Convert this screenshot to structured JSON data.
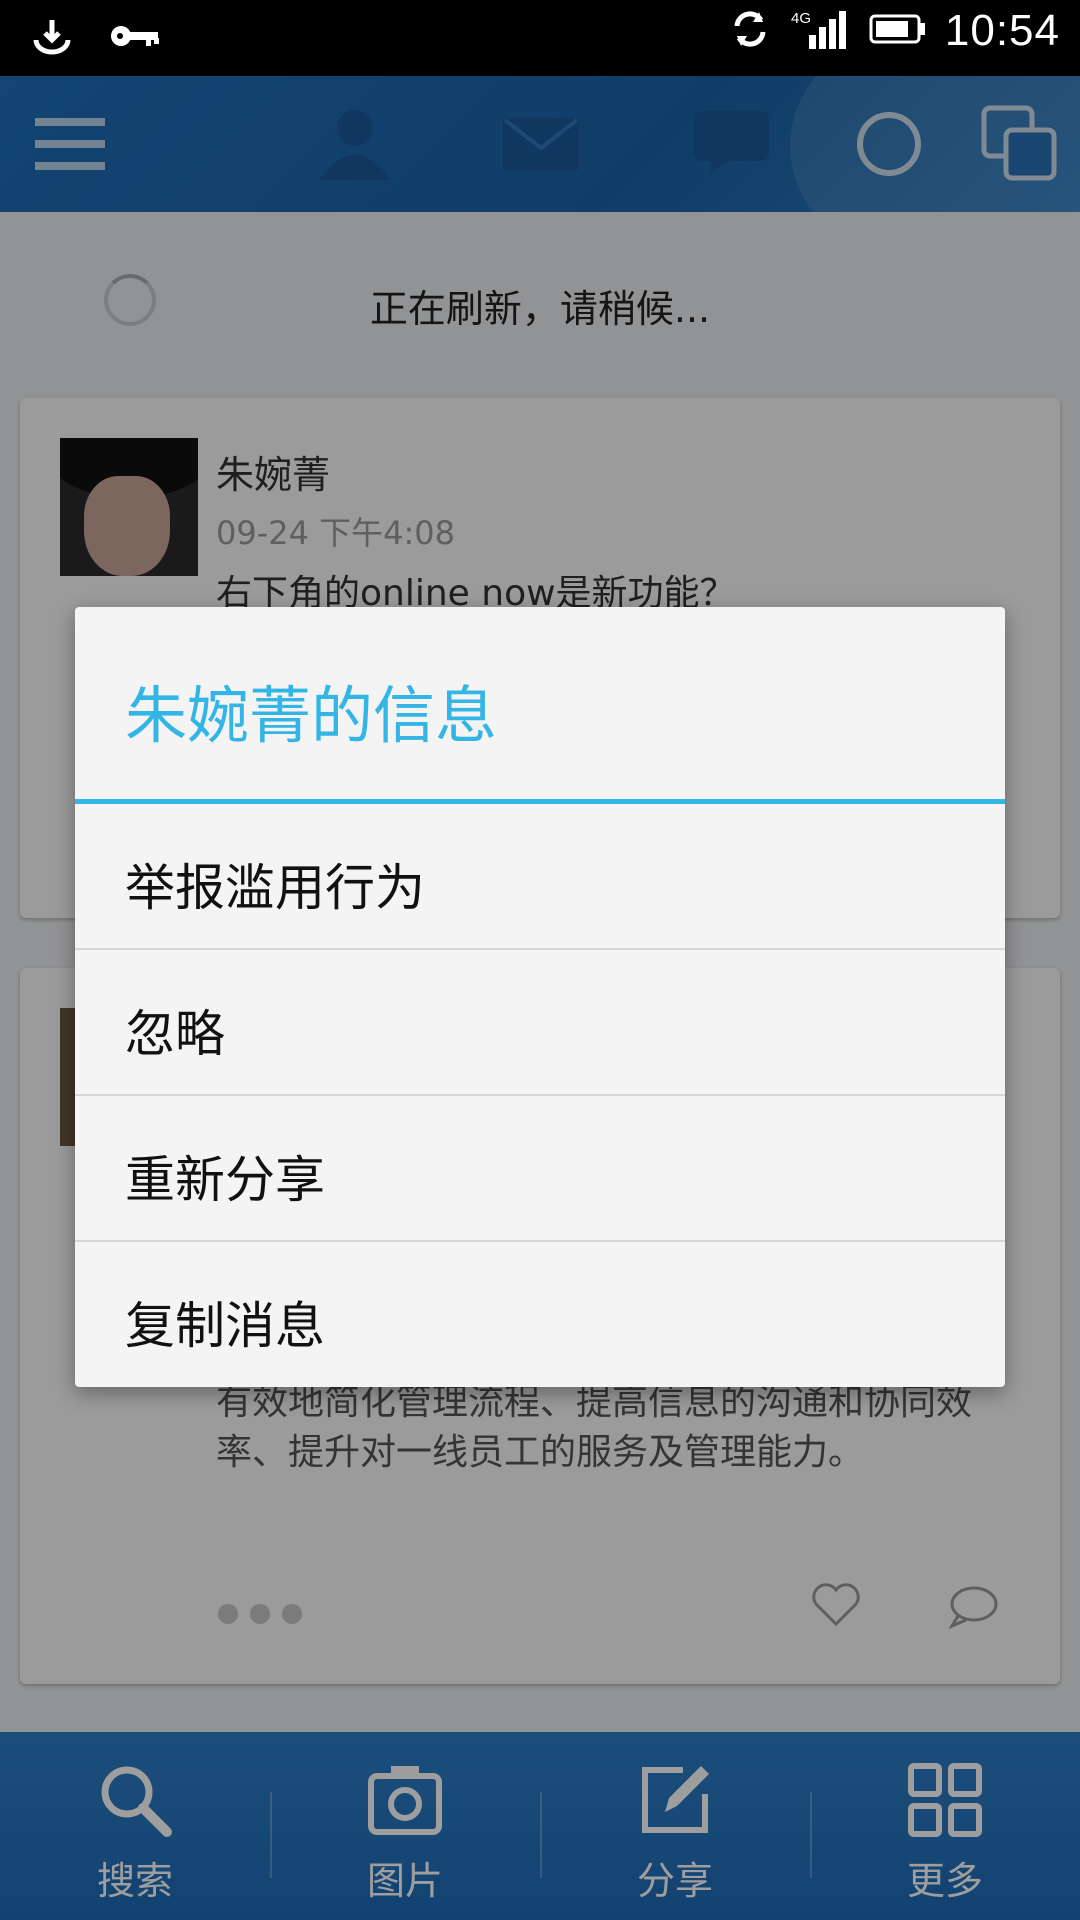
{
  "status_bar": {
    "time": "10:54",
    "network": "4G",
    "icons": [
      "download-icon",
      "key-icon",
      "sync-icon",
      "signal-icon",
      "battery-icon"
    ]
  },
  "top_bar": {
    "icons": [
      "menu-icon",
      "profile-icon",
      "mail-icon",
      "chat-icon",
      "circle-icon",
      "windows-icon"
    ]
  },
  "refresh": {
    "text": "正在刷新，请稍候..."
  },
  "posts": [
    {
      "author": "朱婉菁",
      "time": "09-24 下午4:08",
      "text": "右下角的online now是新功能？"
    },
    {
      "text": "有效地简化管理流程、提高信息的沟通和协同效率、提升对一线员工的服务及管理能力。"
    }
  ],
  "dialog": {
    "title": "朱婉菁的信息",
    "items": [
      "举报滥用行为",
      "忽略",
      "重新分享",
      "复制消息"
    ]
  },
  "bottom_bar": {
    "items": [
      {
        "label": "搜索",
        "icon": "search-icon"
      },
      {
        "label": "图片",
        "icon": "camera-icon"
      },
      {
        "label": "分享",
        "icon": "edit-icon"
      },
      {
        "label": "更多",
        "icon": "grid-icon"
      }
    ]
  },
  "colors": {
    "accent": "#33b5e5",
    "top_bar": "#1f6fb8",
    "bottom_bar": "#1e6bb6"
  }
}
